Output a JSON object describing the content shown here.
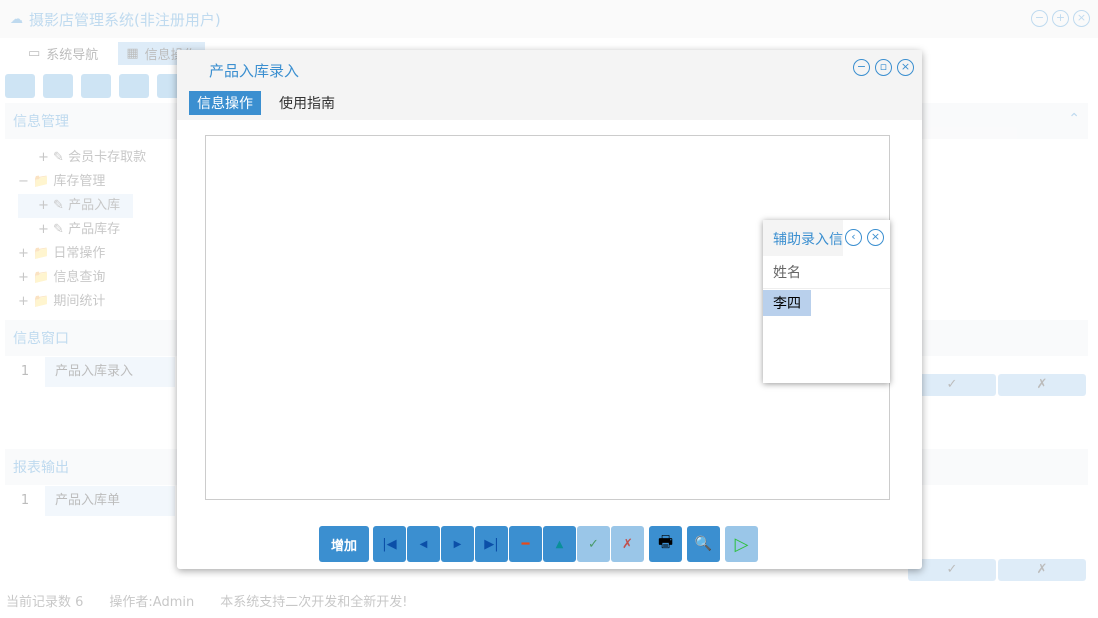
{
  "app": {
    "title": "摄影店管理系统(非注册用户)"
  },
  "nav": {
    "tabs": [
      {
        "label": "系统导航"
      },
      {
        "label": "信息操作"
      }
    ]
  },
  "sidebar": {
    "section_title": "信息管理",
    "tree": [
      "会员卡存取款",
      "库存管理",
      "产品入库",
      "产品库存",
      "日常操作",
      "信息查询",
      "期间统计"
    ]
  },
  "info_window": {
    "title": "信息窗口",
    "rows": [
      {
        "no": "1",
        "name": "产品入库录入"
      }
    ]
  },
  "report": {
    "title": "报表输出",
    "rows": [
      {
        "no": "1",
        "name": "产品入库单"
      }
    ]
  },
  "status": {
    "records": "当前记录数 6",
    "operator": "操作者:Admin",
    "note": "本系统支持二次开发和全新开发!"
  },
  "dialog": {
    "title": "产品入库录入",
    "tabs": [
      "信息操作",
      "使用指南"
    ],
    "add_label": "增加",
    "buttons": {
      "first": "|◀",
      "prev": "◀",
      "next": "▶",
      "last": "▶|",
      "delete": "━",
      "up": "▲",
      "confirm": "✓",
      "cancel": "✗",
      "print": "🖶",
      "preview": "🔍",
      "run": "▷"
    }
  },
  "popup": {
    "title": "辅助录入信",
    "column": "姓名",
    "value": "李四"
  }
}
